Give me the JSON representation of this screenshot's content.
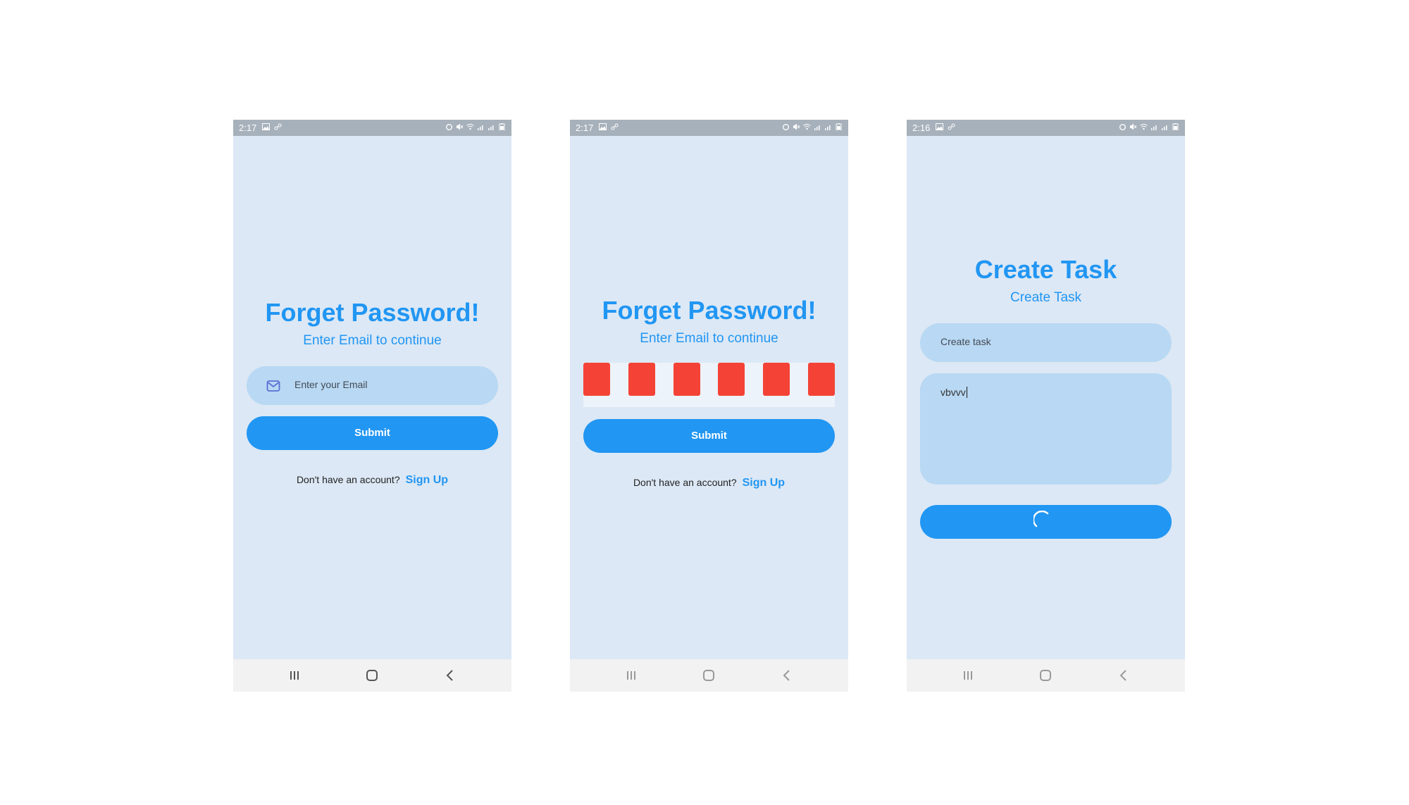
{
  "screens": [
    {
      "status_time": "2:17",
      "title": "Forget Password!",
      "subtitle": "Enter Email to continue",
      "email_placeholder": "Enter your Email",
      "submit_label": "Submit",
      "signup_prompt": "Don't have an account?",
      "signup_link": "Sign Up"
    },
    {
      "status_time": "2:17",
      "title": "Forget Password!",
      "subtitle": "Enter Email to continue",
      "otp_box_count": 6,
      "otp_box_color": "#f44336",
      "submit_label": "Submit",
      "signup_prompt": "Don't have an account?",
      "signup_link": "Sign Up"
    },
    {
      "status_time": "2:16",
      "title": "Create Task",
      "subtitle": "Create Task",
      "task_placeholder": "Create task",
      "description_value": "vbvvv",
      "submit_loading": true
    }
  ],
  "colors": {
    "accent": "#2196f3",
    "screen_bg": "#dce8f5",
    "input_bg": "#b8d8f3",
    "status_bar": "#a7b1bb",
    "nav_bar": "#f2f2f2"
  },
  "icons": {
    "email_field": "mail-icon",
    "nav": [
      "recents-icon",
      "home-icon",
      "back-icon"
    ]
  }
}
